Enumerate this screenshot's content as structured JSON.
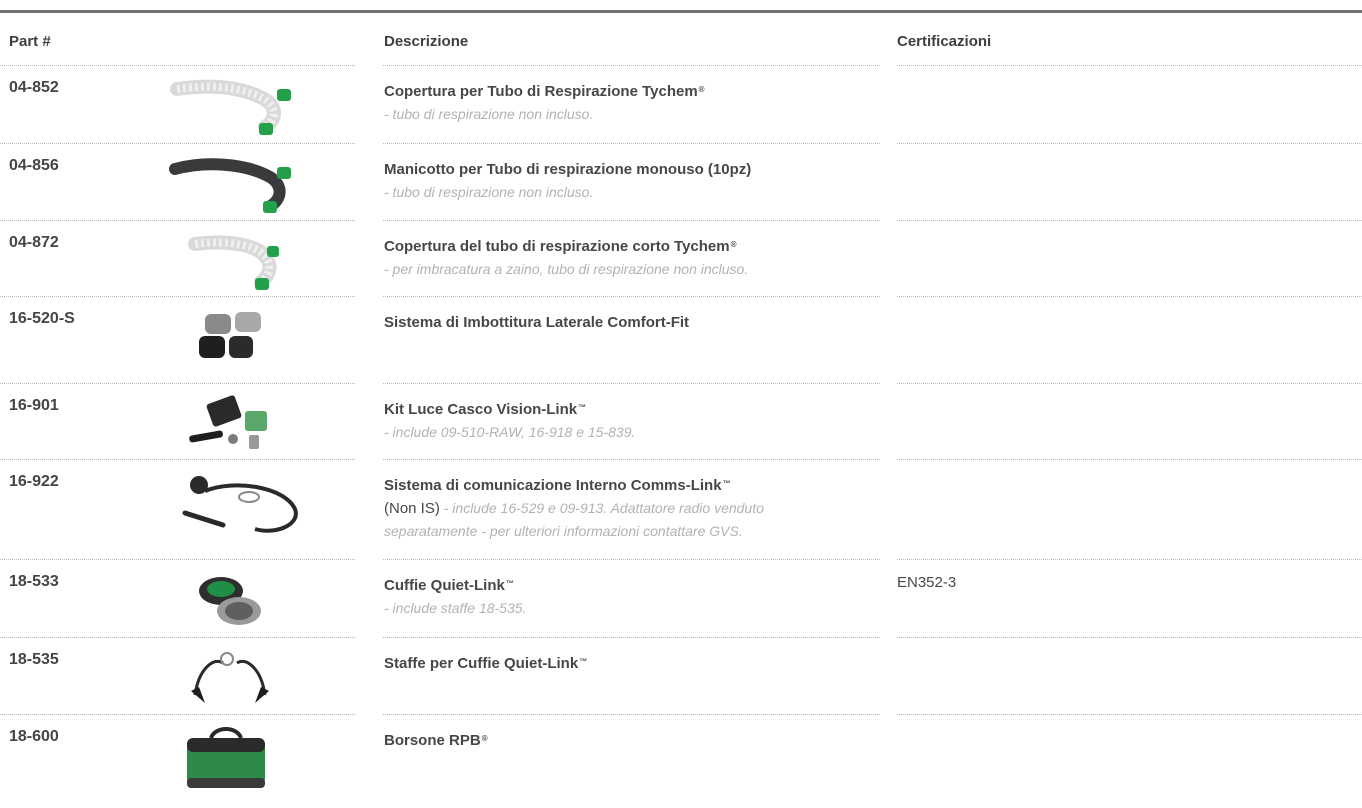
{
  "header": {
    "part": "Part #",
    "descrizione": "Descrizione",
    "certificazioni": "Certificazioni"
  },
  "rows": [
    {
      "part": "04-852",
      "title": "Copertura per Tubo di Respirazione Tychem",
      "title_mark": "®",
      "sub_lines": [
        "- tubo di respirazione non incluso."
      ],
      "cert": "",
      "thumb": "white-hose-cover-icon"
    },
    {
      "part": "04-856",
      "title": "Manicotto per Tubo di respirazione monouso (10pz)",
      "title_mark": "",
      "sub_lines": [
        "- tubo di respirazione non incluso."
      ],
      "cert": "",
      "thumb": "black-hose-sleeve-icon"
    },
    {
      "part": "04-872",
      "title": " Copertura del tubo di respirazione corto Tychem",
      "title_mark": "®",
      "sub_lines": [
        "- per imbracatura a zaino, tubo di respirazione non incluso."
      ],
      "cert": "",
      "thumb": "short-hose-cover-icon"
    },
    {
      "part": "16-520-S",
      "title": "Sistema di Imbottitura Laterale Comfort-Fit",
      "title_mark": "",
      "sub_lines": [],
      "cert": "",
      "thumb": "side-padding-icon"
    },
    {
      "part": "16-901",
      "title": "Kit Luce Casco Vision-Link",
      "title_mark": "™",
      "sub_lines": [
        "- include 09-510-RAW, 16-918 e 15-839."
      ],
      "cert": "",
      "thumb": "helmet-light-kit-icon"
    },
    {
      "part": "16-922",
      "title": "Sistema di comunicazione Interno Comms-Link",
      "title_mark": "™",
      "inline_strong": "(Non IS)",
      "sub_lines": [
        " - include 16-529 e 09-913. Adattatore radio venduto",
        "separatamente - per ulteriori informazioni contattare GVS."
      ],
      "cert": "",
      "thumb": "headset-comms-icon"
    },
    {
      "part": "18-533",
      "title": "Cuffie Quiet-Link",
      "title_mark": "™",
      "sub_lines": [
        "- include staffe 18-535."
      ],
      "cert": "EN352-3",
      "thumb": "earmuffs-icon"
    },
    {
      "part": "18-535",
      "title": "Staffe per Cuffie Quiet-Link",
      "title_mark": "™",
      "sub_lines": [],
      "cert": "",
      "thumb": "earmuff-brackets-icon"
    },
    {
      "part": "18-600",
      "title": "Borsone RPB",
      "title_mark": "®",
      "sub_lines": [],
      "cert": "",
      "thumb": "duffel-bag-icon"
    }
  ]
}
